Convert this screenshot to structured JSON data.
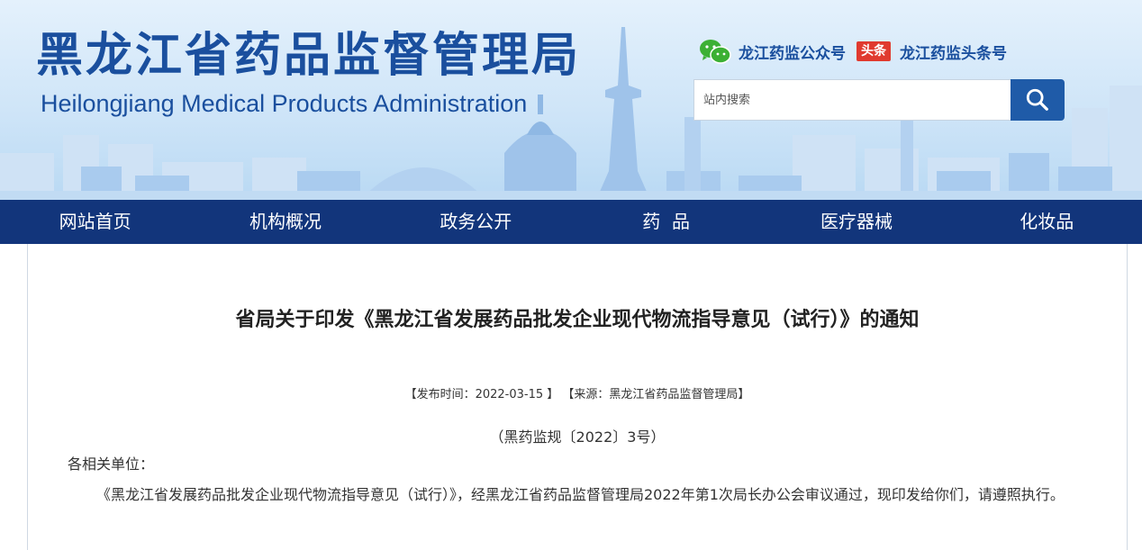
{
  "header": {
    "title_cn": "黑龙江省药品监督管理局",
    "title_en": "Heilongjiang Medical Products Administration",
    "social": {
      "wechat_icon": "wechat-icon",
      "wechat_label": "龙江药监公众号",
      "toutiao_badge": "头条",
      "toutiao_label": "龙江药监头条号"
    },
    "search": {
      "placeholder": "站内搜索",
      "value": "",
      "button_icon": "search-icon"
    }
  },
  "nav": {
    "items": [
      "网站首页",
      "机构概况",
      "政务公开",
      "药  品",
      "医疗器械",
      "化妆品"
    ]
  },
  "article": {
    "title": "省局关于印发《黑龙江省发展药品批发企业现代物流指导意见（试行）》的通知",
    "meta": "【发布时间：2022-03-15 】 【来源：黑龙江省药品监督管理局】",
    "doc_number": "（黑药监规〔2022〕3号）",
    "salutation": "各相关单位：",
    "body": "《黑龙江省发展药品批发企业现代物流指导意见（试行）》，经黑龙江省药品监督管理局2022年第1次局长办公会审议通过，现印发给你们，请遵照执行。"
  },
  "colors": {
    "brand_blue": "#1a4f9e",
    "nav_bg": "#12357b",
    "search_button": "#1f5ba8",
    "toutiao_red": "#e03a2f",
    "wechat_green": "#3cb034"
  }
}
